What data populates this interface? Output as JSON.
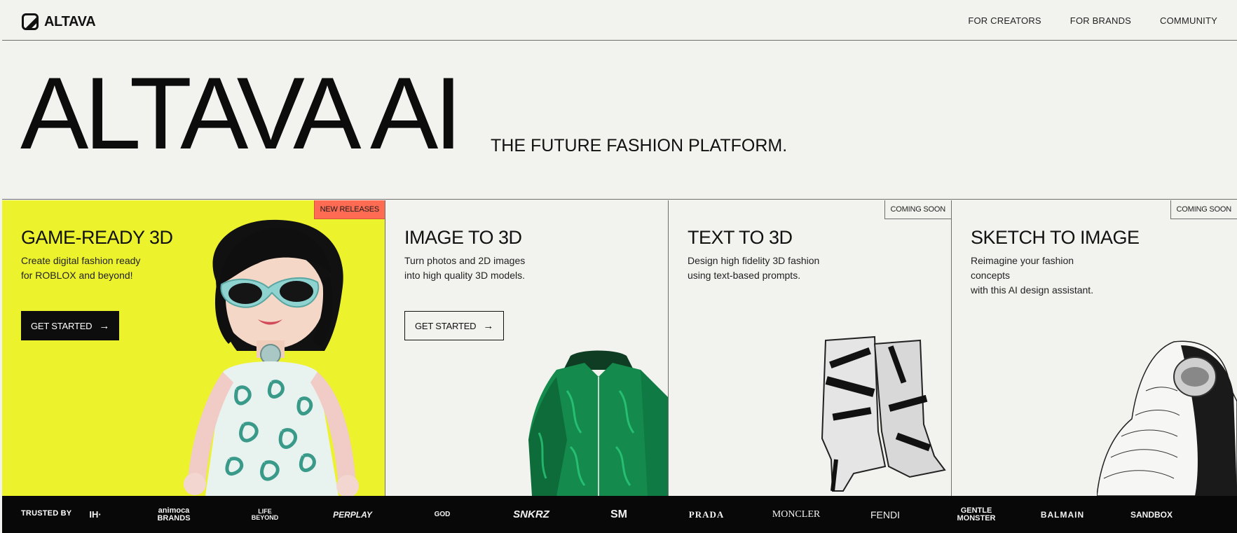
{
  "header": {
    "logo_text": "ALTAVA",
    "nav": [
      "FOR CREATORS",
      "FOR BRANDS",
      "COMMUNITY"
    ]
  },
  "hero": {
    "title": "ALTAVA AI",
    "subtitle": "THE FUTURE FASHION PLATFORM."
  },
  "cards": [
    {
      "badge": "NEW RELEASES",
      "title": "GAME-READY 3D",
      "desc_line1": "Create digital fashion ready",
      "desc_line2": "for ROBLOX and beyond!",
      "cta": "GET STARTED"
    },
    {
      "title": "IMAGE TO 3D",
      "desc_line1": "Turn photos and 2D images",
      "desc_line2": "into high quality 3D models.",
      "cta": "GET STARTED"
    },
    {
      "badge": "COMING SOON",
      "title": "TEXT TO 3D",
      "desc_line1": "Design high fidelity 3D fashion",
      "desc_line2": "using text-based prompts."
    },
    {
      "badge": "COMING SOON",
      "title": "SKETCH TO IMAGE",
      "desc_line1": "Reimagine your fashion concepts",
      "desc_line2": "with this AI design assistant."
    }
  ],
  "trusted": {
    "label": "TRUSTED BY",
    "brands": [
      "IH·",
      "animoca BRANDS",
      "LIFE BEYOND",
      "PERPLAY",
      "GOD",
      "SNKRZ",
      "SM",
      "PRADA",
      "MONCLER",
      "FENDI",
      "GENTLE MONSTER",
      "BALMAIN",
      "SANDBOX"
    ]
  },
  "colors": {
    "accent_yellow": "#ecf22c",
    "badge_new": "#ff6b53",
    "background": "#f2f2ef",
    "trusted_bar": "#080808"
  }
}
